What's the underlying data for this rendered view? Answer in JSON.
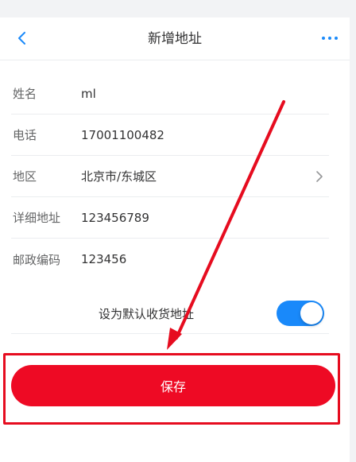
{
  "navbar": {
    "title": "新增地址"
  },
  "form": {
    "fields": [
      {
        "label": "姓名",
        "value": "ml"
      },
      {
        "label": "电话",
        "value": "17001100482"
      },
      {
        "label": "地区",
        "value": "北京市/东城区"
      },
      {
        "label": "详细地址",
        "value": "123456789"
      },
      {
        "label": "邮政编码",
        "value": "123456"
      }
    ],
    "default_label": "设为默认收货地址",
    "default_on": true
  },
  "actions": {
    "save_label": "保存"
  },
  "colors": {
    "accent": "#1989fa",
    "save": "#ee0a24",
    "annotation": "#e60c1f"
  }
}
